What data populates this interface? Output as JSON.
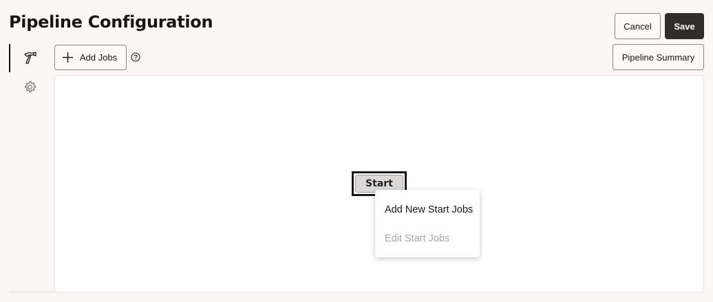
{
  "header": {
    "title": "Pipeline Configuration",
    "cancel_label": "Cancel",
    "save_label": "Save"
  },
  "toolbar": {
    "add_jobs_label": "Add Jobs",
    "pipeline_summary_label": "Pipeline Summary"
  },
  "sidebar": {
    "items": [
      {
        "icon": "hammer-icon",
        "selected": true
      },
      {
        "icon": "gear-icon",
        "selected": false
      }
    ]
  },
  "canvas": {
    "start_node_label": "Start",
    "context_menu": {
      "items": [
        {
          "label": "Add New Start Jobs",
          "enabled": true
        },
        {
          "label": "Edit Start Jobs",
          "enabled": false
        }
      ]
    }
  },
  "colors": {
    "save_button_bg": "#312d2a",
    "background": "#f9f8f6",
    "disabled_text": "#a9a6a2"
  }
}
